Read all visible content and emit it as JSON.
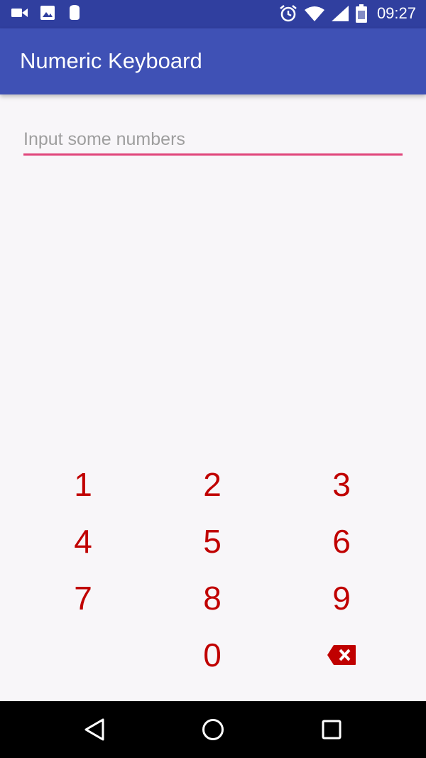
{
  "status_bar": {
    "time": "09:27",
    "left_icons": [
      "video-icon",
      "image-icon",
      "notification-icon"
    ],
    "right_icons": [
      "alarm-icon",
      "wifi-icon",
      "signal-icon",
      "battery-icon"
    ]
  },
  "app_bar": {
    "title": "Numeric Keyboard",
    "color": "#3f51b5",
    "status_color": "#303f9f"
  },
  "input": {
    "value": "",
    "placeholder": "Input some numbers",
    "accent": "#e0457b"
  },
  "keypad": {
    "digit_color": "#c00000",
    "keys": {
      "k1": "1",
      "k2": "2",
      "k3": "3",
      "k4": "4",
      "k5": "5",
      "k6": "6",
      "k7": "7",
      "k8": "8",
      "k9": "9",
      "k0": "0"
    },
    "delete_icon": "backspace-icon"
  },
  "nav_bar": {
    "buttons": [
      "back-icon",
      "home-icon",
      "recents-icon"
    ]
  }
}
